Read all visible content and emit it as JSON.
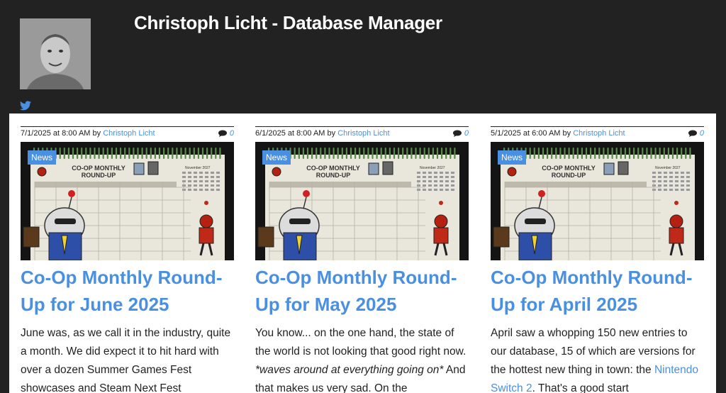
{
  "site": {
    "title": "Christoph Licht - Database Manager",
    "avatar_alt": "profile-photo",
    "twitter_icon": "twitter-icon"
  },
  "colors": {
    "accent": "#4a90e2",
    "background": "#222222",
    "panel": "#ffffff"
  },
  "posts": [
    {
      "date": "7/1/2025 at 8:00 AM",
      "by": "by",
      "author": "Christoph Licht",
      "comments": "0",
      "category": "News",
      "title": "Co-Op Monthly Round-Up for June 2025",
      "excerpt_parts": [
        "June was, as we call it in the industry, quite a month. We did expect it to hit hard with over a dozen Summer Games Fest showcases and Steam Next Fest"
      ],
      "image": {
        "calendar_title": "Co-Op Monthly Round-Up",
        "month": "November 2027"
      }
    },
    {
      "date": "6/1/2025 at 8:00 AM",
      "by": "by",
      "author": "Christoph Licht",
      "comments": "0",
      "category": "News",
      "title": "Co-Op Monthly Round-Up for May 2025",
      "excerpt_parts": [
        "You know... on the one hand, the state of the world is not looking that good right now. ",
        "*waves around at everything going on*",
        " And that makes us very sad. On the"
      ],
      "image": {
        "calendar_title": "Co-Op Monthly Round-Up",
        "month": "November 2027"
      }
    },
    {
      "date": "5/1/2025 at 6:00 AM",
      "by": "by",
      "author": "Christoph Licht",
      "comments": "0",
      "category": "News",
      "title": "Co-Op Monthly Round-Up for April 2025",
      "excerpt_parts": [
        "April saw a whopping 150 new entries to our database, 15 of which are versions for the hottest new thing in town: the ",
        "Nintendo Switch 2",
        ". That's a good start"
      ],
      "image": {
        "calendar_title": "Co-Op Monthly Round-Up",
        "month": "November 2027"
      }
    }
  ]
}
